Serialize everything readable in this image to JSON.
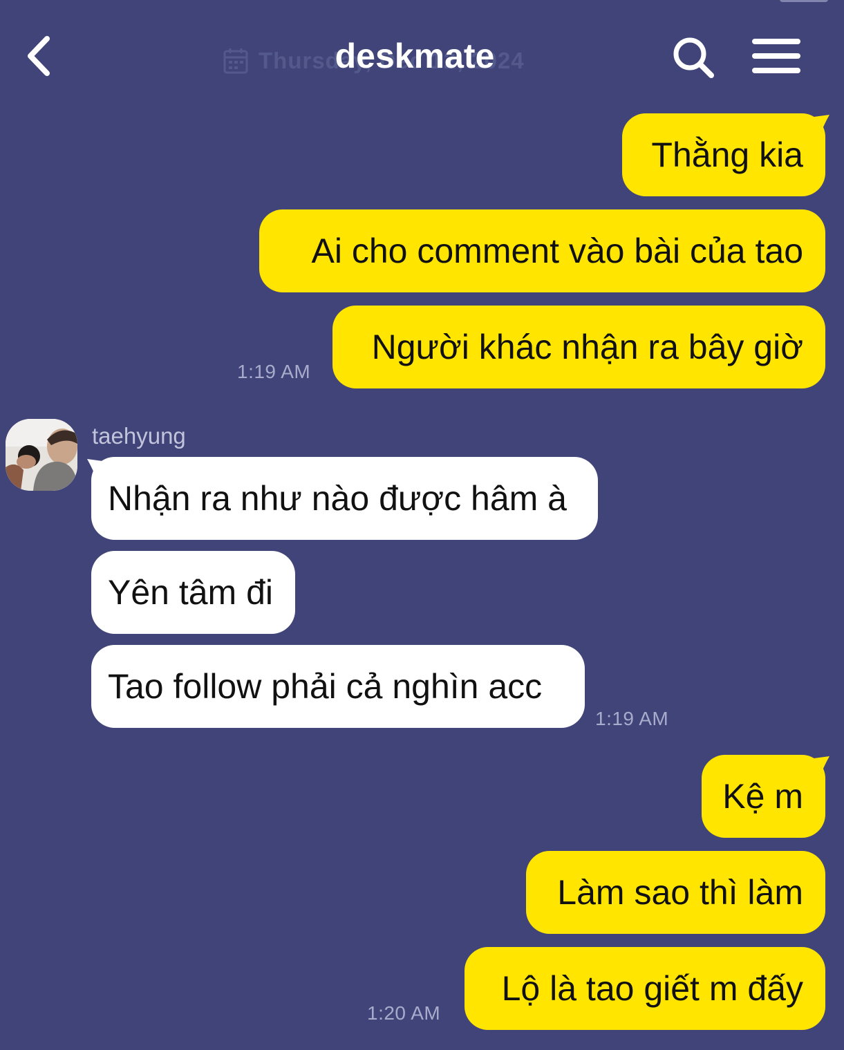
{
  "header": {
    "title": "deskmate",
    "date_label": "Thursday, Dec 12, 2024",
    "back_icon": "chevron-left-icon",
    "search_icon": "search-icon",
    "menu_icon": "menu-icon"
  },
  "colors": {
    "background": "#404478",
    "outgoing_bubble": "#ffe500",
    "incoming_bubble": "#ffffff",
    "timestamp": "#a8abcb"
  },
  "messages": {
    "group1": {
      "m1": "Thằng kia",
      "m2": "Ai cho comment vào bài của tao",
      "m3": "Người khác nhận ra bây giờ",
      "time": "1:19 AM"
    },
    "group2": {
      "sender": "taehyung",
      "m1": "Nhận ra như nào được hâm à",
      "m2": "Yên tâm đi",
      "m3": "Tao follow phải cả nghìn acc",
      "time": "1:19 AM"
    },
    "group3": {
      "m1": "Kệ m",
      "m2": "Làm sao thì làm",
      "m3": "Lộ là tao giết m đấy",
      "time": "1:20 AM"
    }
  }
}
